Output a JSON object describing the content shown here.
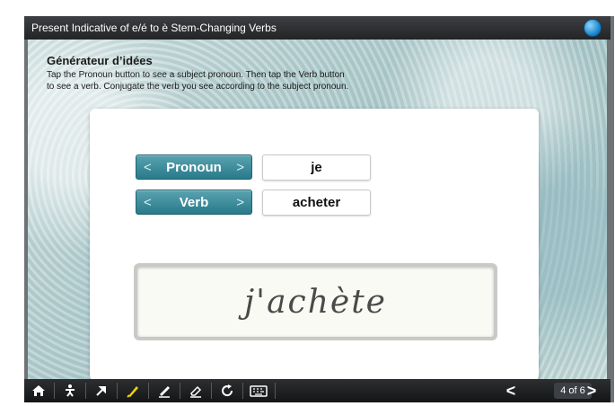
{
  "window": {
    "title": "Present Indicative of e/é to è Stem-Changing Verbs",
    "logo_icon": "globe-icon"
  },
  "instructions": {
    "heading": "Générateur d’idées",
    "line1": "Tap the Pronoun button to see a subject pronoun. Then tap the Verb button",
    "line2": "to see a verb. Conjugate the verb you see according to the subject pronoun."
  },
  "generator": {
    "pronoun_button": {
      "label": "Pronoun",
      "prev": "<",
      "next": ">"
    },
    "verb_button": {
      "label": "Verb",
      "prev": "<",
      "next": ">"
    },
    "pronoun_value": "je",
    "verb_value": "acheter"
  },
  "answer": {
    "handwritten_text": "j'achète"
  },
  "toolbar": {
    "icons": [
      "home-icon",
      "figure-icon",
      "pin-icon",
      "highlighter-icon",
      "pen-icon",
      "eraser-icon",
      "refresh-icon",
      "keyboard-icon"
    ],
    "prev": "<",
    "next": ">",
    "page_indicator": "4 of 6"
  },
  "colors": {
    "accent_button": "#2f8393",
    "titlebar": "#2a2c2f",
    "highlighter": "#f2d300"
  }
}
